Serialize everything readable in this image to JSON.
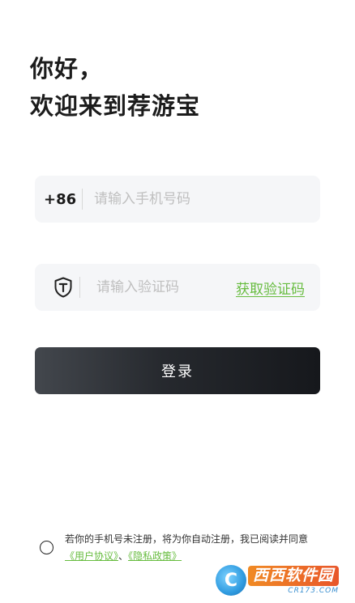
{
  "greeting": {
    "line1": "你好，",
    "line2": "欢迎来到荐游宝"
  },
  "phone_field": {
    "prefix": "+86",
    "value": "",
    "placeholder": "请输入手机号码"
  },
  "code_field": {
    "icon": "shield-t-icon",
    "value": "",
    "placeholder": "请输入验证码",
    "get_code_label": "获取验证码"
  },
  "login_button": {
    "label": "登录"
  },
  "agreement": {
    "checked": false,
    "text_before": "若你的手机号未注册，将为你自动注册，我已阅读并同意",
    "user_agreement": "《用户协议》",
    "separator": "、",
    "privacy_policy": "《隐私政策》"
  },
  "watermark": {
    "logo_letter": "C",
    "text": "西西软件园",
    "subtext": "CR173.COM"
  },
  "colors": {
    "accent_green": "#67bc3f",
    "button_dark": "#1c1e22",
    "field_bg": "#f5f6f8",
    "placeholder": "#bfbfbf"
  }
}
